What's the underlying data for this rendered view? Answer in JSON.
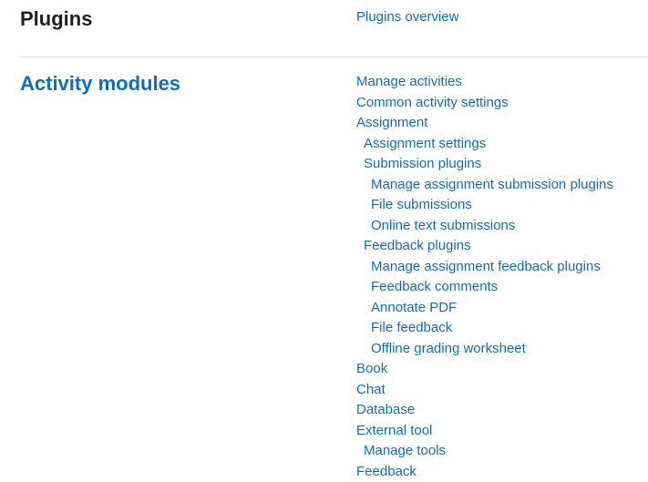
{
  "plugins_section": {
    "title": "Plugins",
    "links": [
      {
        "label": "Plugins overview"
      }
    ]
  },
  "activity_modules_section": {
    "title": "Activity modules",
    "links": [
      {
        "label": "Manage activities"
      },
      {
        "label": "Common activity settings"
      },
      {
        "label": "Assignment"
      },
      {
        "label": "Assignment settings"
      },
      {
        "label": "Submission plugins"
      },
      {
        "label": "Manage assignment submission plugins"
      },
      {
        "label": "File submissions"
      },
      {
        "label": "Online text submissions"
      },
      {
        "label": "Feedback plugins"
      },
      {
        "label": "Manage assignment feedback plugins"
      },
      {
        "label": "Feedback comments"
      },
      {
        "label": "Annotate PDF"
      },
      {
        "label": "File feedback"
      },
      {
        "label": "Offline grading worksheet"
      },
      {
        "label": "Book"
      },
      {
        "label": "Chat"
      },
      {
        "label": "Database"
      },
      {
        "label": "External tool"
      },
      {
        "label": "Manage tools"
      },
      {
        "label": "Feedback"
      }
    ]
  },
  "colors": {
    "link": "#0f6cbf",
    "heading": "#1d2125",
    "divider": "#dee2e6"
  }
}
